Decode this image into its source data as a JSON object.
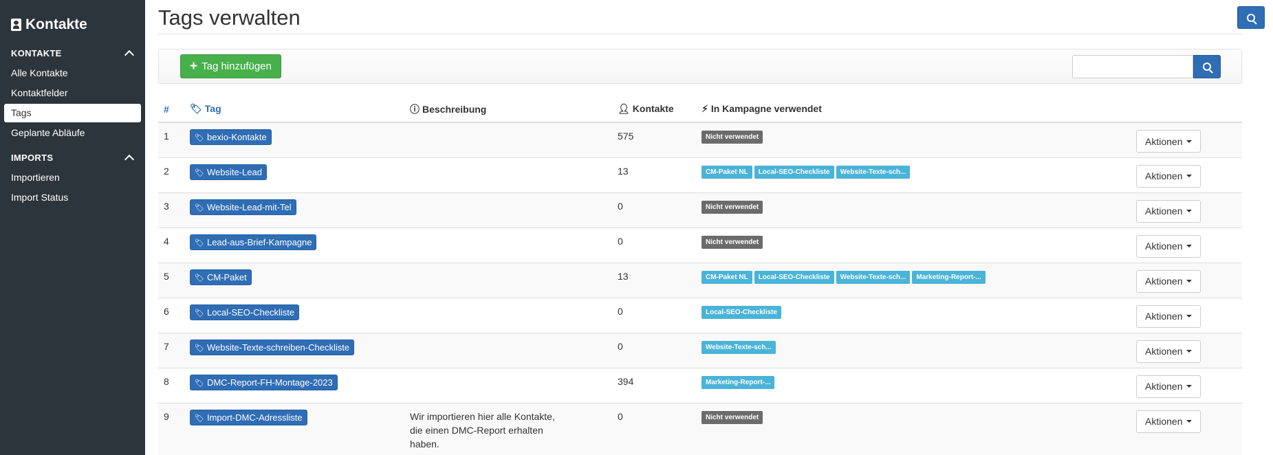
{
  "sidebar": {
    "brand": "Kontakte",
    "sections": [
      {
        "title": "KONTAKTE",
        "items": [
          "Alle Kontakte",
          "Kontaktfelder",
          "Tags",
          "Geplante Abläufe"
        ]
      },
      {
        "title": "IMPORTS",
        "items": [
          "Importieren",
          "Import Status"
        ]
      }
    ],
    "active_item": "Tags"
  },
  "header": {
    "title": "Tags verwalten"
  },
  "toolbar": {
    "add_label": "Tag hinzufügen",
    "search_value": ""
  },
  "table": {
    "columns": [
      "#",
      "Tag",
      "Beschreibung",
      "Kontakte",
      "In Kampagne verwendet"
    ],
    "action_label": "Aktionen",
    "rows": [
      {
        "n": "1",
        "tag": "bexio-Kontakte",
        "desc": "",
        "count": "575",
        "campaigns": [
          {
            "label": "Nicht verwendet",
            "kind": "grey"
          }
        ]
      },
      {
        "n": "2",
        "tag": "Website-Lead",
        "desc": "",
        "count": "13",
        "campaigns": [
          {
            "label": "CM-Paket NL",
            "kind": "blue"
          },
          {
            "label": "Local-SEO-Checkliste",
            "kind": "blue"
          },
          {
            "label": "Website-Texte-sch...",
            "kind": "blue"
          }
        ]
      },
      {
        "n": "3",
        "tag": "Website-Lead-mit-Tel",
        "desc": "",
        "count": "0",
        "campaigns": [
          {
            "label": "Nicht verwendet",
            "kind": "grey"
          }
        ]
      },
      {
        "n": "4",
        "tag": "Lead-aus-Brief-Kampagne",
        "desc": "",
        "count": "0",
        "campaigns": [
          {
            "label": "Nicht verwendet",
            "kind": "grey"
          }
        ]
      },
      {
        "n": "5",
        "tag": "CM-Paket",
        "desc": "",
        "count": "13",
        "campaigns": [
          {
            "label": "CM-Paket NL",
            "kind": "blue"
          },
          {
            "label": "Local-SEO-Checkliste",
            "kind": "blue"
          },
          {
            "label": "Website-Texte-sch...",
            "kind": "blue"
          },
          {
            "label": "Marketing-Report-...",
            "kind": "blue"
          }
        ]
      },
      {
        "n": "6",
        "tag": "Local-SEO-Checkliste",
        "desc": "",
        "count": "0",
        "campaigns": [
          {
            "label": "Local-SEO-Checkliste",
            "kind": "blue"
          }
        ]
      },
      {
        "n": "7",
        "tag": "Website-Texte-schreiben-Checkliste",
        "desc": "",
        "count": "0",
        "campaigns": [
          {
            "label": "Website-Texte-sch...",
            "kind": "blue"
          }
        ]
      },
      {
        "n": "8",
        "tag": "DMC-Report-FH-Montage-2023",
        "desc": "",
        "count": "394",
        "campaigns": [
          {
            "label": "Marketing-Report-...",
            "kind": "blue"
          }
        ]
      },
      {
        "n": "9",
        "tag": "Import-DMC-Adressliste",
        "desc": "Wir importieren hier alle Kontakte, die einen DMC-Report erhalten haben.",
        "count": "0",
        "campaigns": [
          {
            "label": "Nicht verwendet",
            "kind": "grey"
          }
        ]
      }
    ]
  },
  "colors": {
    "sidebar_bg": "#2d353c",
    "primary": "#2f6db5",
    "success": "#47b04b",
    "info": "#4ab3d8",
    "muted": "#6b6b6b"
  }
}
